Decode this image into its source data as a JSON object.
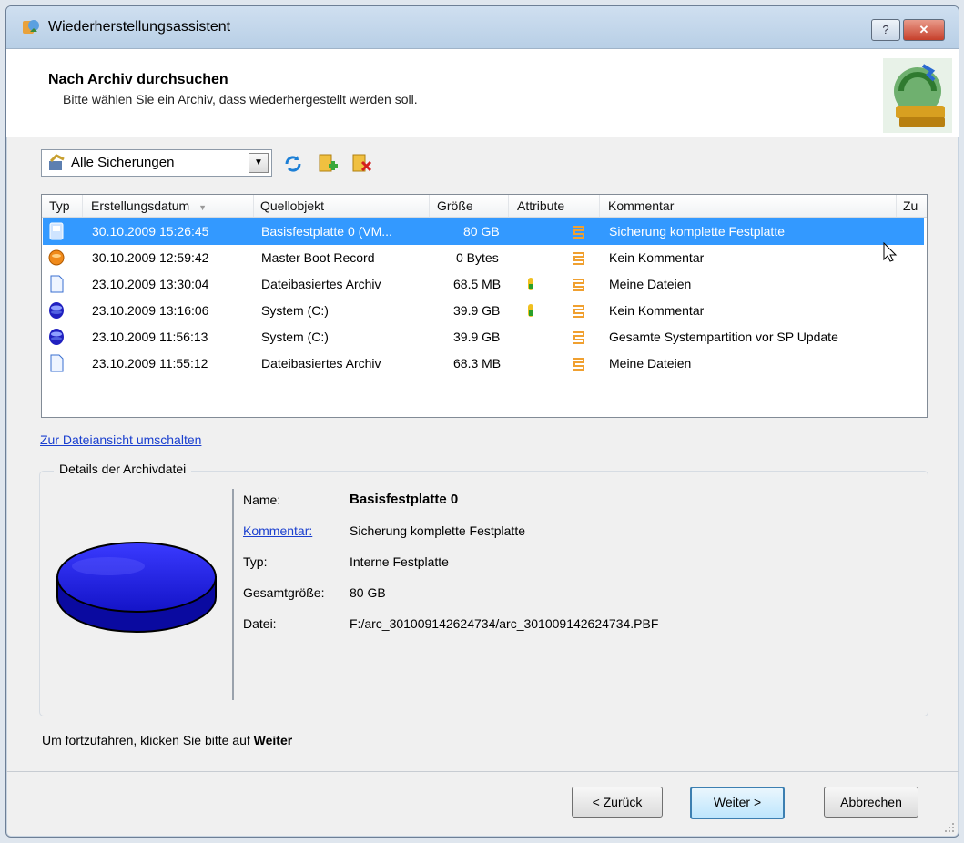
{
  "window": {
    "title": "Wiederherstellungsassistent"
  },
  "header": {
    "title": "Nach Archiv durchsuchen",
    "subtitle": "Bitte wählen Sie ein Archiv, dass wiederhergestellt werden soll."
  },
  "filter": {
    "selected": "Alle Sicherungen"
  },
  "columns": [
    "Typ",
    "Erstellungsdatum",
    "Quellobjekt",
    "Größe",
    "Attribute",
    "Kommentar",
    "Zu"
  ],
  "rows": [
    {
      "icon": "disk-archive-icon",
      "date": "30.10.2009 15:26:45",
      "source": "Basisfestplatte 0 (VM...",
      "size": "80 GB",
      "comment": "Sicherung komplette Festplatte"
    },
    {
      "icon": "mbr-icon",
      "date": "30.10.2009 12:59:42",
      "source": "Master Boot Record",
      "size": "0 Bytes",
      "comment": "Kein Kommentar"
    },
    {
      "icon": "file-archive-icon",
      "date": "23.10.2009 13:30:04",
      "source": "Dateibasiertes Archiv",
      "size": "68.5 MB",
      "comment": "Meine Dateien"
    },
    {
      "icon": "partition-icon",
      "date": "23.10.2009 13:16:06",
      "source": "System (C:)",
      "size": "39.9 GB",
      "comment": "Kein Kommentar"
    },
    {
      "icon": "partition-icon",
      "date": "23.10.2009 11:56:13",
      "source": "System (C:)",
      "size": "39.9 GB",
      "comment": "Gesamte Systempartition vor SP Update"
    },
    {
      "icon": "file-archive-icon",
      "date": "23.10.2009 11:55:12",
      "source": "Dateibasiertes Archiv",
      "size": "68.3 MB",
      "comment": "Meine Dateien"
    }
  ],
  "switch_link": "Zur Dateiansicht umschalten",
  "details": {
    "group_title": "Details der Archivdatei",
    "name_label": "Name:",
    "name_value": "Basisfestplatte 0",
    "comment_label": "Kommentar:",
    "comment_value": "Sicherung komplette Festplatte",
    "type_label": "Typ:",
    "type_value": "Interne Festplatte",
    "size_label": "Gesamtgröße:",
    "size_value": "80 GB",
    "file_label": "Datei:",
    "file_value": "F:/arc_301009142624734/arc_301009142624734.PBF"
  },
  "footer": {
    "hint": "Um fortzufahren, klicken Sie bitte auf",
    "hint_bold": "Weiter"
  },
  "buttons": {
    "back": "< Zurück",
    "next": "Weiter >",
    "cancel": "Abbrechen"
  },
  "colors": {
    "selection": "#3399ff",
    "link": "#1a3fcf",
    "disk": "#1f1fd6"
  }
}
